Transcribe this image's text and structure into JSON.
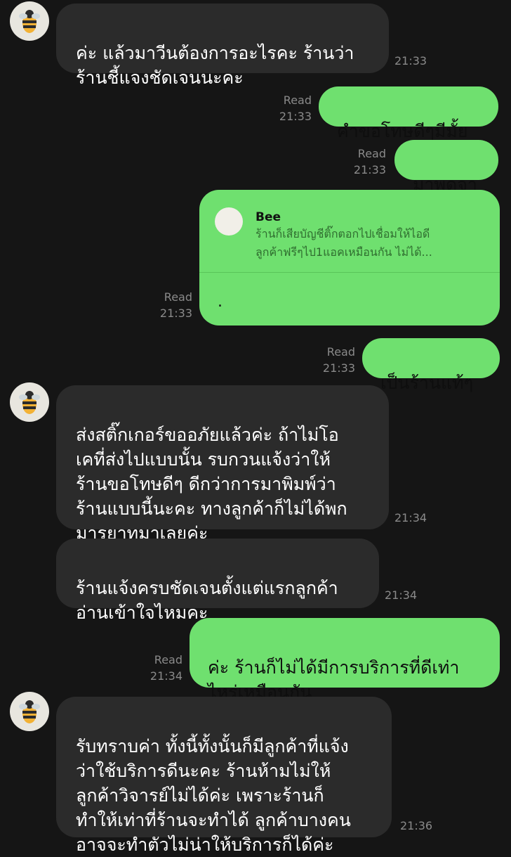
{
  "contact": {
    "name": "Bee",
    "avatar_icon": "bee-avatar-icon"
  },
  "colors": {
    "background": "#151515",
    "incoming_bubble": "#2b2b2b",
    "outgoing_bubble": "#6fe06f",
    "meta_text": "#8a8a8a"
  },
  "messages": [
    {
      "direction": "in",
      "text": "ค่ะ แล้วมาวีนต้องการอะไรคะ ร้านว่า\nร้านชี้แจงชัดเจนนะคะ",
      "time": "21:33"
    },
    {
      "direction": "out",
      "text": "คำขอโทษดีๆมีมั้ย",
      "read": "Read",
      "time": "21:33"
    },
    {
      "direction": "out",
      "text": "มาพูดจา",
      "read": "Read",
      "time": "21:33"
    },
    {
      "direction": "out",
      "reply_to_name": "Bee",
      "reply_to_text": "ร้านก็เสียบัญชีติ๊กตอกไปเชื่อมให้ไอดี\nลูกค้าฟรีๆไป1แอคเหมือนกัน ไม่ได้...",
      "text": ".",
      "read": "Read",
      "time": "21:33"
    },
    {
      "direction": "out",
      "text": "เป็นร้านแท้ๆ",
      "read": "Read",
      "time": "21:33"
    },
    {
      "direction": "in",
      "text": "ส่งสติ๊กเกอร์ขออภัยแล้วค่ะ ถ้าไม่โอ\nเคที่ส่งไปแบบนั้น รบกวนแจ้งว่าให้\nร้านขอโทษดีๆ ดีกว่าการมาพิมพ์ว่า\nร้านแบบนี้นะคะ ทางลูกค้าก็ไม่ได้พก\nมารยาทมาเลยค่ะ",
      "time": "21:34"
    },
    {
      "direction": "in",
      "text": "ร้านแจ้งครบชัดเจนตั้งแต่แรกลูกค้า\nอ่านเข้าใจไหมคะ",
      "time": "21:34"
    },
    {
      "direction": "out",
      "text": "ค่ะ ร้านก็ไม่ได้มีการบริการที่ดีเท่า\nไหร่เหมือนกัน",
      "read": "Read",
      "time": "21:34"
    },
    {
      "direction": "in",
      "text": "รับทราบค่า ทั้งนี้ทั้งนั้นก็มีลูกค้าที่แจ้ง\nว่าใช้บริการดีนะคะ ร้านห้ามไม่ให้\nลูกค้าวิจารย์ไม่ได้ค่ะ เพราะร้านก็\nทำให้เท่าที่ร้านจะทำได้ ลูกค้าบางคน\nอาจจะทำตัวไม่น่าให้บริการก็ได้ค่ะ",
      "time": "21:36"
    }
  ]
}
